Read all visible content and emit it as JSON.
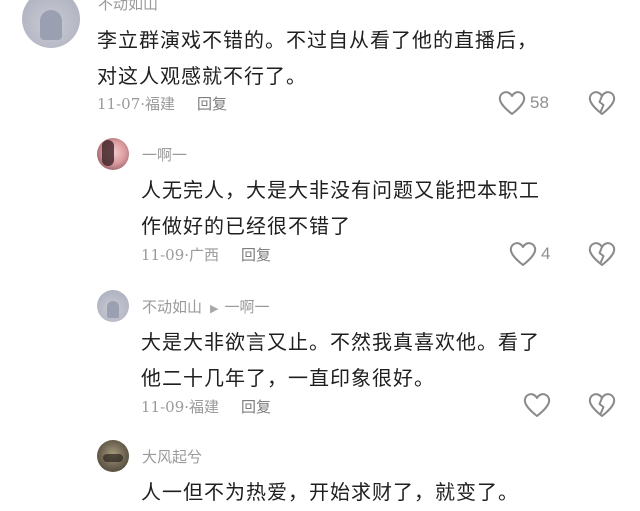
{
  "comments": [
    {
      "author": "不动如山",
      "text_lines": [
        "李立群演戏不错的。不过自从看了他的直播后，",
        "对这人观感就不行了。"
      ],
      "date": "11-07",
      "location": "福建",
      "reply_label": "回复",
      "likes": "58"
    },
    {
      "author": "一啊一",
      "text_lines": [
        "人无完人，大是大非没有问题又能把本职工",
        "作做好的已经很不错了"
      ],
      "date": "11-09",
      "location": "广西",
      "reply_label": "回复",
      "likes": "4"
    },
    {
      "author": "不动如山",
      "reply_to": "一啊一",
      "text_lines": [
        "大是大非欲言又止。不然我真喜欢他。看了",
        "他二十几年了，一直印象很好。"
      ],
      "date": "11-09",
      "location": "福建",
      "reply_label": "回复",
      "likes": ""
    },
    {
      "author": "大风起兮",
      "text_lines": [
        "人一但不为热爱，开始求财了，就变了。"
      ]
    }
  ],
  "icons": {
    "like": "heart-outline-icon",
    "dislike": "broken-heart-icon",
    "reply_arrow": "triangle-right-icon"
  },
  "colors": {
    "meta_text": "#9a9a9a",
    "icon_stroke": "#8a8a8a"
  }
}
